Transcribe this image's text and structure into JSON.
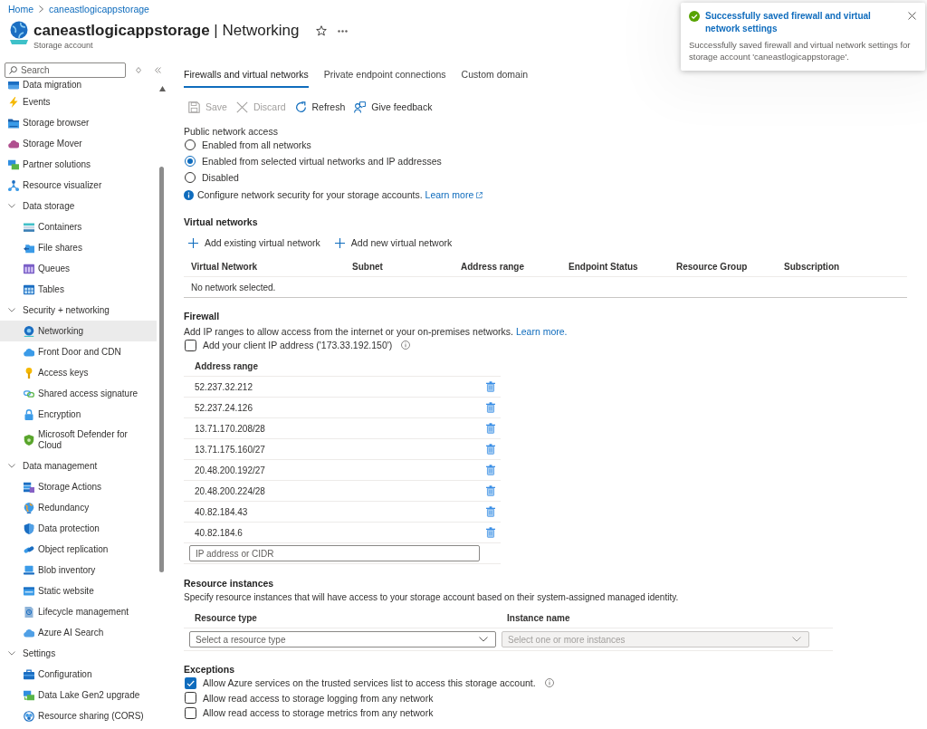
{
  "breadcrumb": [
    "Home",
    "caneastlogicappstorage"
  ],
  "header": {
    "title": "**caneastlogicappstorage** | Networking",
    "subtitle": "Storage account"
  },
  "notification": {
    "title": "Successfully saved firewall and virtual network settings",
    "message": "Successfully saved firewall and virtual network settings for storage account 'caneastlogicappstorage'."
  },
  "sidebar": {
    "search": {
      "placeholder": "Search"
    },
    "items": [
      {
        "label": "Data migration",
        "selected": false
      },
      {
        "label": "Events",
        "selected": false
      },
      {
        "label": "Storage browser",
        "selected": false
      },
      {
        "label": "Storage Mover",
        "selected": false
      },
      {
        "label": "Partner solutions",
        "selected": false
      },
      {
        "label": "Resource visualizer",
        "selected": false
      },
      {
        "label": "Data storage",
        "selected": false,
        "expanded": true,
        "children": [
          {
            "label": "Containers",
            "selected": false
          },
          {
            "label": "File shares",
            "selected": false
          },
          {
            "label": "Queues",
            "selected": false
          },
          {
            "label": "Tables",
            "selected": false
          }
        ]
      },
      {
        "label": "Security + networking",
        "selected": false,
        "expanded": true,
        "children": [
          {
            "label": "Networking",
            "selected": true
          },
          {
            "label": "Front Door and CDN",
            "selected": false
          },
          {
            "label": "Access keys",
            "selected": false
          },
          {
            "label": "Shared access signature",
            "selected": false
          },
          {
            "label": "Encryption",
            "selected": false
          },
          {
            "label": "Microsoft Defender for Cloud",
            "selected": false
          }
        ]
      },
      {
        "label": "Data management",
        "selected": false,
        "expanded": true,
        "children": [
          {
            "label": "Storage Actions",
            "selected": false
          },
          {
            "label": "Redundancy",
            "selected": false
          },
          {
            "label": "Data protection",
            "selected": false
          },
          {
            "label": "Object replication",
            "selected": false
          },
          {
            "label": "Blob inventory",
            "selected": false
          },
          {
            "label": "Static website",
            "selected": false
          },
          {
            "label": "Lifecycle management",
            "selected": false
          },
          {
            "label": "Azure AI Search",
            "selected": false
          }
        ]
      },
      {
        "label": "Settings",
        "selected": false,
        "expanded": true,
        "children": [
          {
            "label": "Configuration",
            "selected": false
          },
          {
            "label": "Data Lake Gen2 upgrade",
            "selected": false
          },
          {
            "label": "Resource sharing (CORS)",
            "selected": false
          }
        ]
      }
    ]
  },
  "tabs": [
    {
      "label": "Firewalls and virtual networks",
      "selected": true
    },
    {
      "label": "Private endpoint connections",
      "selected": false
    },
    {
      "label": "Custom domain",
      "selected": false
    }
  ],
  "toolbar": [
    {
      "label": "Save",
      "kind": "save",
      "disabled": true
    },
    {
      "label": "Discard",
      "kind": "discard",
      "disabled": true
    },
    {
      "label": "Refresh",
      "kind": "refresh",
      "disabled": false
    },
    {
      "label": "Give feedback",
      "kind": "feedback",
      "disabled": false
    }
  ],
  "public_network_access": {
    "label": "Public network access",
    "options": [
      {
        "label": "Enabled from all networks",
        "selected": false
      },
      {
        "label": "Enabled from selected virtual networks and IP addresses",
        "selected": true
      },
      {
        "label": "Disabled",
        "selected": false
      }
    ],
    "info": {
      "text": "Configure network security for your storage accounts.",
      "link": "Learn more"
    }
  },
  "virtual_networks": {
    "heading": "Virtual networks",
    "actions": [
      "Add existing virtual network",
      "Add new virtual network"
    ],
    "columns": [
      "Virtual Network",
      "Subnet",
      "Address range",
      "Endpoint Status",
      "Resource Group",
      "Subscription"
    ],
    "empty_message": "No network selected."
  },
  "firewall": {
    "heading": "Firewall",
    "description": "Add IP ranges to allow access from the internet or your on-premises networks.",
    "link": "Learn more.",
    "client_ip": {
      "label": "Add your client IP address ('173.33.192.150')",
      "checked": false
    },
    "column": "Address range",
    "addresses": [
      "52.237.32.212",
      "52.237.24.126",
      "13.71.170.208/28",
      "13.71.175.160/27",
      "20.48.200.192/27",
      "20.48.200.224/28",
      "40.82.184.43",
      "40.82.184.6"
    ],
    "input": {
      "placeholder": "IP address or CIDR"
    }
  },
  "resource_instances": {
    "heading": "Resource instances",
    "description": "Specify resource instances that will have access to your storage account based on their system-assigned managed identity.",
    "columns": [
      "Resource type",
      "Instance name"
    ],
    "resource_type": {
      "placeholder": "Select a resource type",
      "disabled": false
    },
    "instance_name": {
      "placeholder": "Select one or more instances",
      "disabled": true
    }
  },
  "exceptions": {
    "heading": "Exceptions",
    "options": [
      {
        "label": "Allow Azure services on the trusted services list to access this storage account.",
        "checked": true,
        "info": true
      },
      {
        "label": "Allow read access to storage logging from any network",
        "checked": false,
        "info": false
      },
      {
        "label": "Allow read access to storage metrics from any network",
        "checked": false,
        "info": false
      }
    ]
  }
}
